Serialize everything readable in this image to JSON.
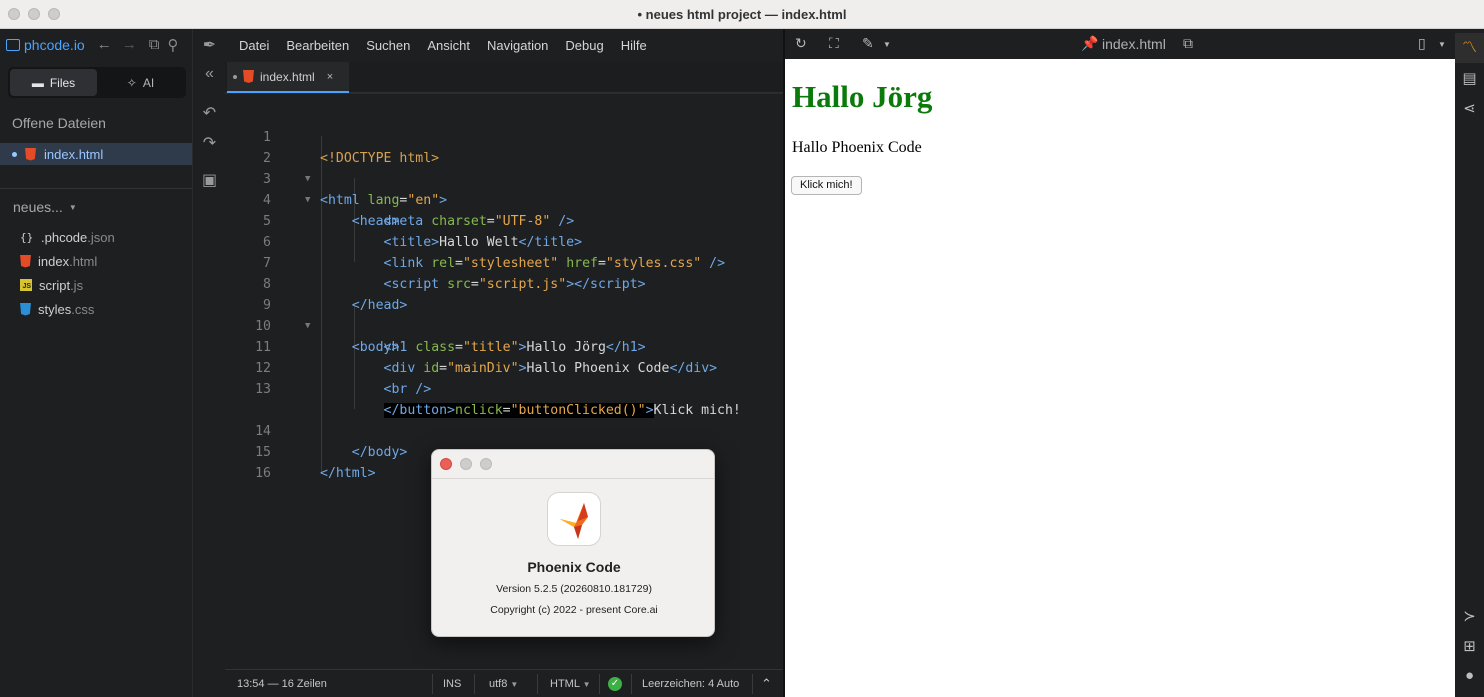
{
  "window": {
    "title": "• neues html project — index.html"
  },
  "sidebar": {
    "brand": "phcode.io",
    "tabs": [
      {
        "label": "Files",
        "active": true
      },
      {
        "label": "AI",
        "active": false
      }
    ],
    "open_files_heading": "Offene Dateien",
    "open_files": [
      {
        "name": "index.html"
      }
    ],
    "project_name": "neues...",
    "files": [
      {
        "base": ".phcode",
        "ext": ".json",
        "icon": "json-icon"
      },
      {
        "base": "index",
        "ext": ".html",
        "icon": "html-file-icon"
      },
      {
        "base": "script",
        "ext": ".js",
        "icon": "js-file-icon"
      },
      {
        "base": "styles",
        "ext": ".css",
        "icon": "css-file-icon"
      }
    ]
  },
  "menu": {
    "items": [
      "Datei",
      "Bearbeiten",
      "Suchen",
      "Ansicht",
      "Navigation",
      "Debug",
      "Hilfe"
    ]
  },
  "editor_tab": {
    "filename": "index.html",
    "close": "×"
  },
  "editor": {
    "line_numbers": [
      "1",
      "2",
      "3",
      "4",
      "5",
      "6",
      "7",
      "8",
      "9",
      "10",
      "11",
      "12",
      "13",
      "14",
      "15",
      "16"
    ]
  },
  "statusbar": {
    "position": "13:54 — 16 Zeilen",
    "mode": "INS",
    "encoding": "utf8",
    "language": "HTML",
    "indent_label": "Leerzeichen:",
    "indent_value": "4 Auto"
  },
  "preview_toolbar": {
    "filename": "index.html"
  },
  "preview": {
    "heading": "Hallo Jörg",
    "div_text": "Hallo Phoenix Code",
    "button_label": "Klick mich!"
  },
  "about_dialog": {
    "app_name": "Phoenix Code",
    "version": "Version 5.2.5 (20260810.181729)",
    "copyright": "Copyright (c) 2022 - present Core.ai"
  },
  "colors": {
    "accent": "#4aa3ff",
    "preview_heading": "#0a7a0a",
    "close_red": "#ec5f57",
    "ok_green": "#3cb043"
  }
}
